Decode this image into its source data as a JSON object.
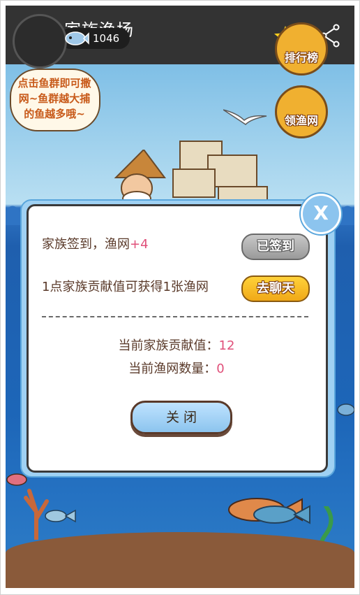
{
  "header": {
    "title": "家族渔场",
    "icons": [
      "back-arrow-icon",
      "star-icon",
      "share-icon"
    ],
    "star_color": "#FFD21F",
    "bar_color": "#333333"
  },
  "player": {
    "fish_coins": "1046"
  },
  "game_buttons": {
    "rank_label": "排行榜",
    "net_label": "领渔网"
  },
  "speech_bubble": {
    "text": "点击鱼群即可撒网~鱼群越大捕的鱼越多哦~"
  },
  "dialog": {
    "signin_text": "家族签到，渔网",
    "signin_bonus": "+4",
    "signed_button": "已签到",
    "contribution_text": "1点家族贡献值可获得1张渔网",
    "chat_button": "去聊天",
    "current_contribution_label": "当前家族贡献值：",
    "current_contribution_value": "12",
    "current_net_label": "当前渔网数量：",
    "current_net_value": "0",
    "close_button": "关 闭",
    "close_x": "X"
  },
  "colors": {
    "accent_pink": "#E0507A",
    "text_brown": "#5A3A2A",
    "dialog_blue": "#9FD1F3"
  }
}
